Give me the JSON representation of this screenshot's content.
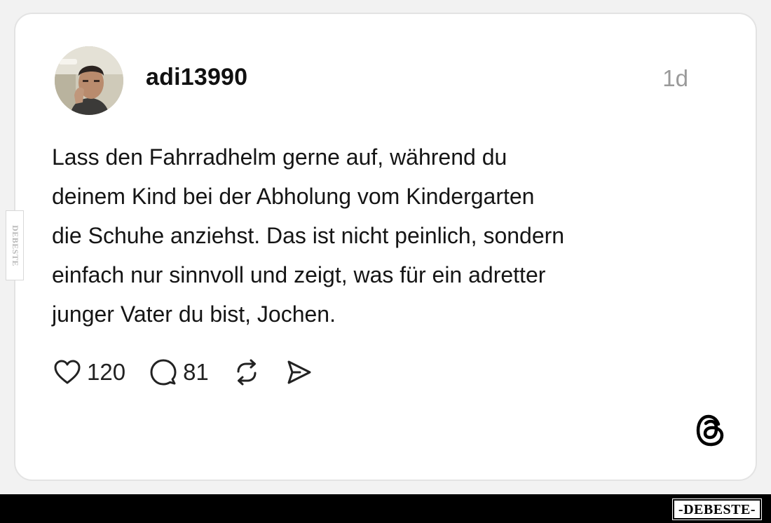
{
  "post": {
    "username": "adi13990",
    "time": "1d",
    "text_lines": [
      "Lass den Fahrradhelm gerne auf, während du",
      "deinem Kind bei der Abholung vom Kindergarten",
      "die Schuhe anziehst. Das ist nicht peinlich, sondern",
      "einfach nur sinnvoll und zeigt, was für ein adretter",
      "junger Vater du bist, Jochen."
    ],
    "likes": "120",
    "replies": "81"
  },
  "icons": {
    "like": "heart-icon",
    "reply": "comment-icon",
    "repost": "repost-icon",
    "share": "send-icon",
    "brand": "threads-logo-icon"
  },
  "watermark": {
    "side": "DEBESTE",
    "bottom": "-DEBESTE-"
  },
  "colors": {
    "background": "#f2f2f2",
    "card": "#ffffff",
    "text": "#151515",
    "muted": "#9a9a9a",
    "bar": "#000000"
  }
}
